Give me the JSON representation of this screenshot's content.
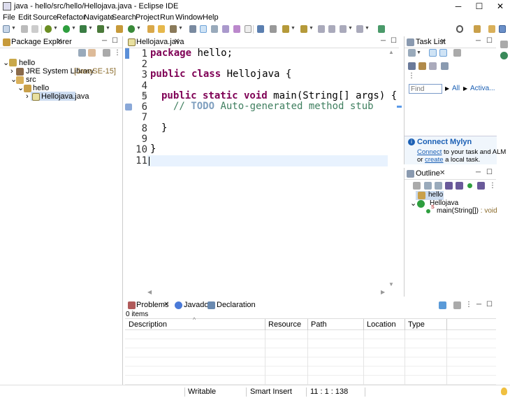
{
  "window": {
    "title": "java - hello/src/hello/Hellojava.java - Eclipse IDE",
    "minimize": "─",
    "maximize": "☐",
    "close": "✕"
  },
  "menu": [
    "File",
    "Edit",
    "Source",
    "Refactor",
    "Navigate",
    "Search",
    "Project",
    "Run",
    "Window",
    "Help"
  ],
  "package_explorer": {
    "tab": "Package Explorer",
    "tree": [
      {
        "label": "hello",
        "expander": "⌄"
      },
      {
        "label": "JRE System Library",
        "suffix": "[JavaSE-15]",
        "expander": "›"
      },
      {
        "label": "src",
        "expander": "⌄"
      },
      {
        "label": "hello",
        "expander": "⌄"
      },
      {
        "label": "Hellojava.java",
        "expander": "›"
      }
    ]
  },
  "editor": {
    "tab": "Hellojava.java",
    "fold_marker": "⊖",
    "line_numbers": [
      "1",
      "2",
      "3",
      "4",
      "5",
      "6",
      "7",
      "8",
      "9",
      "10",
      "11"
    ],
    "lines": {
      "l1_kw": "package",
      "l1_rest": " hello;",
      "l3_kw": "public class",
      "l3_rest": " Hellojava {",
      "l5_kw": "public static void",
      "l5_rest": " main(String[] args) {",
      "l6_cm1": "// ",
      "l6_todo": "TODO",
      "l6_cm2": " Auto-generated method stub",
      "l8": "}",
      "l10": "}"
    }
  },
  "task_list": {
    "tab": "Task List",
    "find_placeholder": "Find",
    "all": "All",
    "activate": "Activa...",
    "mylyn_title": "Connect Mylyn",
    "mylyn_connect": "Connect",
    "mylyn_text1": " to your task and ALM",
    "mylyn_or": "or ",
    "mylyn_create": "create",
    "mylyn_text2": " a local task."
  },
  "outline": {
    "tab": "Outline",
    "items": [
      {
        "label": "hello"
      },
      {
        "label": "Hellojava",
        "expander": "⌄"
      },
      {
        "label": "main(String[])",
        "type": " : void",
        "modifier": "S"
      }
    ]
  },
  "problems": {
    "tabs": [
      "Problems",
      "Javadoc",
      "Declaration"
    ],
    "count": "0 items",
    "columns": [
      "Description",
      "Resource",
      "Path",
      "Location",
      "Type"
    ],
    "sort_indicator": "^"
  },
  "status": {
    "writable": "Writable",
    "insert": "Smart Insert",
    "position": "11 : 1 : 138"
  },
  "colors": {
    "accent": "#1a5fb4",
    "keyword": "#7f0055",
    "comment": "#3f7f5f",
    "todo": "#7f9fbf",
    "current_line": "#e8f2fe"
  }
}
